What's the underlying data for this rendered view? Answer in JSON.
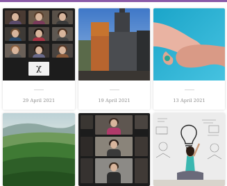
{
  "accent_color": "#8a5aa8",
  "cards": [
    {
      "image": "video-call-grid",
      "date": "29 April 2021"
    },
    {
      "image": "old-town-church",
      "date": "19 April 2021"
    },
    {
      "image": "handshake",
      "date": "13 April 2021"
    },
    {
      "image": "green-hills-landscape"
    },
    {
      "image": "video-call-participants"
    },
    {
      "image": "whiteboard-lightbulb-drawing"
    }
  ]
}
